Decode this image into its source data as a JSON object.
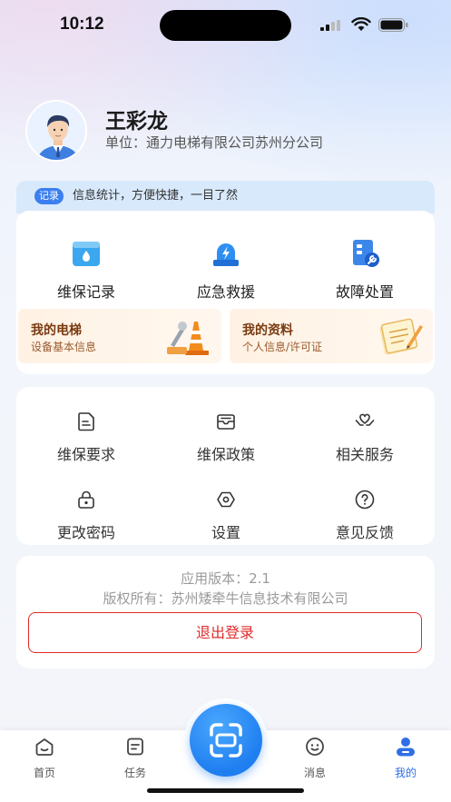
{
  "status_bar": {
    "time": "10:12"
  },
  "profile": {
    "name": "王彩龙",
    "unit": "单位：通力电梯有限公司苏州分公司"
  },
  "record_banner": {
    "tag": "记录",
    "text": "信息统计，方便快捷，一目了然"
  },
  "quick_actions": [
    {
      "label": "维保记录",
      "icon": "folder-icon"
    },
    {
      "label": "应急救援",
      "icon": "siren-icon"
    },
    {
      "label": "故障处置",
      "icon": "repair-icon"
    }
  ],
  "info_cards": [
    {
      "title": "我的电梯",
      "subtitle": "设备基本信息",
      "icon": "traffic-cone-icon"
    },
    {
      "title": "我的资料",
      "subtitle": "个人信息/许可证",
      "icon": "notepad-icon"
    }
  ],
  "services": [
    {
      "label": "维保要求",
      "icon": "document-icon"
    },
    {
      "label": "维保政策",
      "icon": "envelope-icon"
    },
    {
      "label": "相关服务",
      "icon": "hands-heart-icon"
    },
    {
      "label": "更改密码",
      "icon": "lock-icon"
    },
    {
      "label": "设置",
      "icon": "hexagon-settings-icon"
    },
    {
      "label": "意见反馈",
      "icon": "question-icon"
    }
  ],
  "about": {
    "version": "应用版本：2.1",
    "copyright": "版权所有：苏州矮牵牛信息技术有限公司",
    "logout": "退出登录"
  },
  "tabs": [
    {
      "label": "首页",
      "icon": "home-icon",
      "active": false
    },
    {
      "label": "任务",
      "icon": "task-icon",
      "active": false
    },
    {
      "label": "消息",
      "icon": "message-icon",
      "active": false
    },
    {
      "label": "我的",
      "icon": "user-icon",
      "active": true
    }
  ],
  "colors": {
    "accent": "#2f6fe6",
    "danger": "#e02b2b",
    "warm": "#7a3a10"
  }
}
